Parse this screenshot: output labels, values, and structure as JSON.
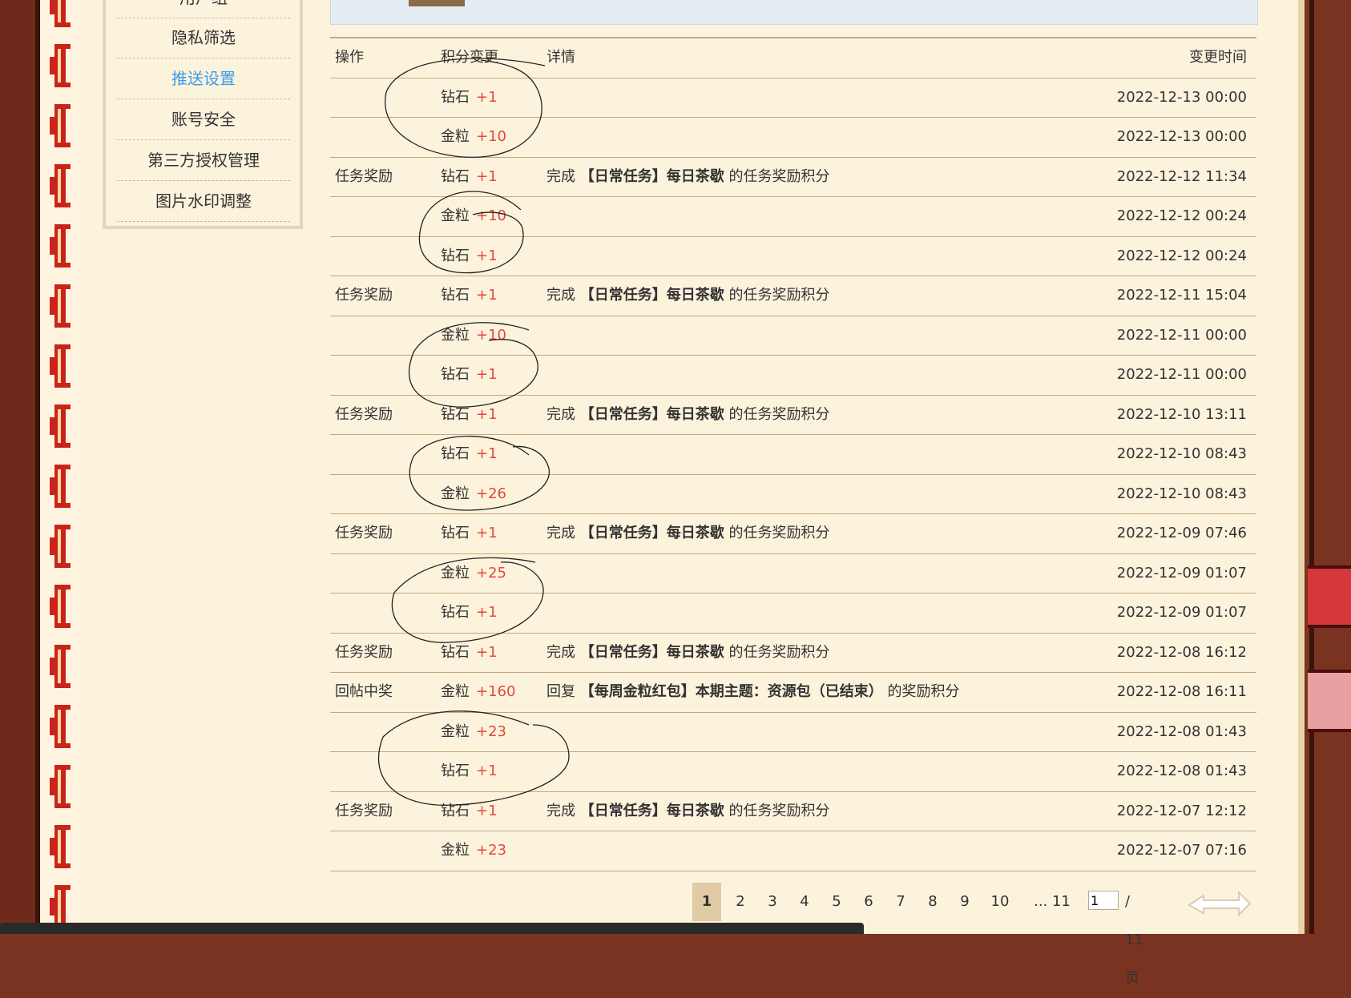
{
  "sidebar": {
    "items": [
      {
        "label": "用户组",
        "active": false
      },
      {
        "label": "隐私筛选",
        "active": false
      },
      {
        "label": "推送设置",
        "active": true
      },
      {
        "label": "账号安全",
        "active": false
      },
      {
        "label": "第三方授权管理",
        "active": false
      },
      {
        "label": "图片水印调整",
        "active": false
      }
    ]
  },
  "table": {
    "headers": {
      "op": "操作",
      "points": "积分变更",
      "detail": "详情",
      "time": "变更时间"
    },
    "rows": [
      {
        "op": "",
        "type": "钻石",
        "val": "+1",
        "det_pre": "",
        "det_strong": "",
        "det_post": "",
        "time": "2022-12-13 00:00"
      },
      {
        "op": "",
        "type": "金粒",
        "val": "+10",
        "det_pre": "",
        "det_strong": "",
        "det_post": "",
        "time": "2022-12-13 00:00"
      },
      {
        "op": "任务奖励",
        "type": "钻石",
        "val": "+1",
        "det_pre": "完成 ",
        "det_strong": "【日常任务】每日茶歇",
        "det_post": " 的任务奖励积分",
        "time": "2022-12-12 11:34"
      },
      {
        "op": "",
        "type": "金粒",
        "val": "+10",
        "det_pre": "",
        "det_strong": "",
        "det_post": "",
        "time": "2022-12-12 00:24"
      },
      {
        "op": "",
        "type": "钻石",
        "val": "+1",
        "det_pre": "",
        "det_strong": "",
        "det_post": "",
        "time": "2022-12-12 00:24"
      },
      {
        "op": "任务奖励",
        "type": "钻石",
        "val": "+1",
        "det_pre": "完成 ",
        "det_strong": "【日常任务】每日茶歇",
        "det_post": " 的任务奖励积分",
        "time": "2022-12-11 15:04"
      },
      {
        "op": "",
        "type": "金粒",
        "val": "+10",
        "det_pre": "",
        "det_strong": "",
        "det_post": "",
        "time": "2022-12-11 00:00"
      },
      {
        "op": "",
        "type": "钻石",
        "val": "+1",
        "det_pre": "",
        "det_strong": "",
        "det_post": "",
        "time": "2022-12-11 00:00"
      },
      {
        "op": "任务奖励",
        "type": "钻石",
        "val": "+1",
        "det_pre": "完成 ",
        "det_strong": "【日常任务】每日茶歇",
        "det_post": " 的任务奖励积分",
        "time": "2022-12-10 13:11"
      },
      {
        "op": "",
        "type": "钻石",
        "val": "+1",
        "det_pre": "",
        "det_strong": "",
        "det_post": "",
        "time": "2022-12-10 08:43"
      },
      {
        "op": "",
        "type": "金粒",
        "val": "+26",
        "det_pre": "",
        "det_strong": "",
        "det_post": "",
        "time": "2022-12-10 08:43"
      },
      {
        "op": "任务奖励",
        "type": "钻石",
        "val": "+1",
        "det_pre": "完成 ",
        "det_strong": "【日常任务】每日茶歇",
        "det_post": " 的任务奖励积分",
        "time": "2022-12-09 07:46"
      },
      {
        "op": "",
        "type": "金粒",
        "val": "+25",
        "det_pre": "",
        "det_strong": "",
        "det_post": "",
        "time": "2022-12-09 01:07"
      },
      {
        "op": "",
        "type": "钻石",
        "val": "+1",
        "det_pre": "",
        "det_strong": "",
        "det_post": "",
        "time": "2022-12-09 01:07"
      },
      {
        "op": "任务奖励",
        "type": "钻石",
        "val": "+1",
        "det_pre": "完成 ",
        "det_strong": "【日常任务】每日茶歇",
        "det_post": " 的任务奖励积分",
        "time": "2022-12-08 16:12"
      },
      {
        "op": "回帖中奖",
        "type": "金粒",
        "val": "+160",
        "det_pre": "回复 ",
        "det_strong": "【每周金粒红包】本期主题：资源包（已结束）",
        "det_post": " 的奖励积分",
        "time": "2022-12-08 16:11"
      },
      {
        "op": "",
        "type": "金粒",
        "val": "+23",
        "det_pre": "",
        "det_strong": "",
        "det_post": "",
        "time": "2022-12-08 01:43"
      },
      {
        "op": "",
        "type": "钻石",
        "val": "+1",
        "det_pre": "",
        "det_strong": "",
        "det_post": "",
        "time": "2022-12-08 01:43"
      },
      {
        "op": "任务奖励",
        "type": "钻石",
        "val": "+1",
        "det_pre": "完成 ",
        "det_strong": "【日常任务】每日茶歇",
        "det_post": " 的任务奖励积分",
        "time": "2022-12-07 12:12"
      },
      {
        "op": "",
        "type": "金粒",
        "val": "+23",
        "det_pre": "",
        "det_strong": "",
        "det_post": "",
        "time": "2022-12-07 07:16"
      }
    ]
  },
  "pagination": {
    "pages": [
      "1",
      "2",
      "3",
      "4",
      "5",
      "6",
      "7",
      "8",
      "9",
      "10"
    ],
    "current": "1",
    "last_label": "... 11",
    "input_value": "1",
    "total_label": "/ 11 页"
  },
  "colors": {
    "points_value": "#e5473c",
    "active_link": "#3d9be9",
    "row_border": "#c3a87e"
  }
}
